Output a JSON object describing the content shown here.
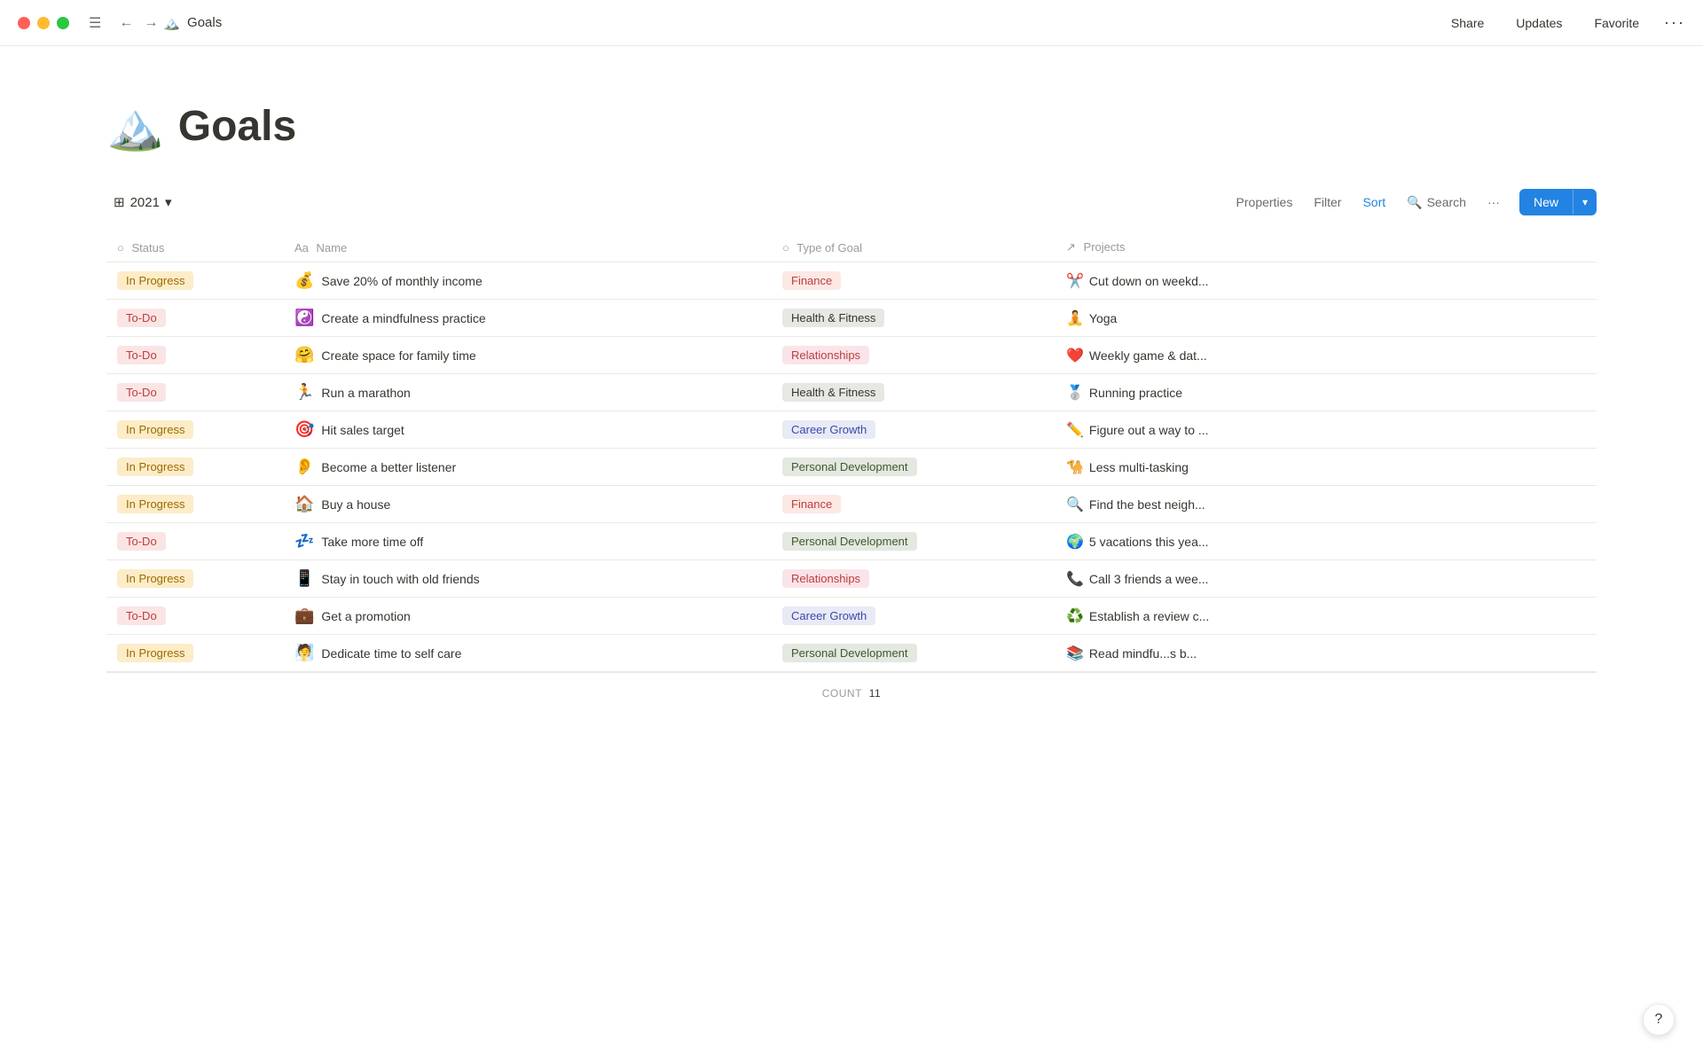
{
  "titlebar": {
    "page_icon": "🏔️",
    "page_title": "Goals",
    "nav": {
      "back_label": "←",
      "forward_label": "→",
      "hamburger_label": "☰"
    },
    "share_label": "Share",
    "updates_label": "Updates",
    "favorite_label": "Favorite",
    "more_label": "···"
  },
  "page": {
    "icon": "🏔️",
    "title": "Goals"
  },
  "toolbar": {
    "view_icon": "⊞",
    "view_label": "2021",
    "view_chevron": "▾",
    "properties_label": "Properties",
    "filter_label": "Filter",
    "sort_label": "Sort",
    "search_icon": "🔍",
    "search_label": "Search",
    "more_label": "···",
    "new_label": "New",
    "new_chevron": "▾"
  },
  "table": {
    "columns": [
      {
        "id": "status",
        "icon": "○",
        "label": "Status"
      },
      {
        "id": "name",
        "icon": "Aa",
        "label": "Name"
      },
      {
        "id": "goal_type",
        "icon": "○",
        "label": "Type of Goal"
      },
      {
        "id": "projects",
        "icon": "↗",
        "label": "Projects"
      }
    ],
    "rows": [
      {
        "status": "In Progress",
        "status_type": "in-progress",
        "icon": "💰",
        "name": "Save 20% of monthly income",
        "goal_type": "Finance",
        "goal_class": "goal-finance",
        "project_icon": "✂️",
        "project": "Cut down on weekd..."
      },
      {
        "status": "To-Do",
        "status_type": "to-do",
        "icon": "☯️",
        "name": "Create a mindfulness practice",
        "goal_type": "Health & Fitness",
        "goal_class": "goal-health",
        "project_icon": "🧘",
        "project": "Yoga"
      },
      {
        "status": "To-Do",
        "status_type": "to-do",
        "icon": "🤗",
        "name": "Create space for family time",
        "goal_type": "Relationships",
        "goal_class": "goal-relationships",
        "project_icon": "❤️",
        "project": "Weekly game & dat..."
      },
      {
        "status": "To-Do",
        "status_type": "to-do",
        "icon": "🏃",
        "name": "Run a marathon",
        "goal_type": "Health & Fitness",
        "goal_class": "goal-health",
        "project_icon": "🥈",
        "project": "Running practice"
      },
      {
        "status": "In Progress",
        "status_type": "in-progress",
        "icon": "🎯",
        "name": "Hit sales target",
        "goal_type": "Career Growth",
        "goal_class": "goal-career",
        "project_icon": "✏️",
        "project": "Figure out a way to ..."
      },
      {
        "status": "In Progress",
        "status_type": "in-progress",
        "icon": "👂",
        "name": "Become a better listener",
        "goal_type": "Personal Development",
        "goal_class": "goal-personal",
        "project_icon": "🐪",
        "project": "Less multi-tasking"
      },
      {
        "status": "In Progress",
        "status_type": "in-progress",
        "icon": "🏠",
        "name": "Buy a house",
        "goal_type": "Finance",
        "goal_class": "goal-finance",
        "project_icon": "🔍",
        "project": "Find the best neigh..."
      },
      {
        "status": "To-Do",
        "status_type": "to-do",
        "icon": "💤",
        "name": "Take more time off",
        "goal_type": "Personal Development",
        "goal_class": "goal-personal",
        "project_icon": "🌍",
        "project": "5 vacations this yea..."
      },
      {
        "status": "In Progress",
        "status_type": "in-progress",
        "icon": "📱",
        "name": "Stay in touch with old friends",
        "goal_type": "Relationships",
        "goal_class": "goal-relationships",
        "project_icon": "📞",
        "project": "Call 3 friends a wee..."
      },
      {
        "status": "To-Do",
        "status_type": "to-do",
        "icon": "💼",
        "name": "Get a promotion",
        "goal_type": "Career Growth",
        "goal_class": "goal-career",
        "project_icon": "♻️",
        "project": "Establish a review c..."
      },
      {
        "status": "In Progress",
        "status_type": "in-progress",
        "icon": "🧖",
        "name": "Dedicate time to self care",
        "goal_type": "Personal Development",
        "goal_class": "goal-personal",
        "project_icon": "📚",
        "project": "Read mindfu...s b..."
      }
    ],
    "count_label": "COUNT",
    "count_value": "11"
  },
  "help": {
    "label": "?"
  }
}
